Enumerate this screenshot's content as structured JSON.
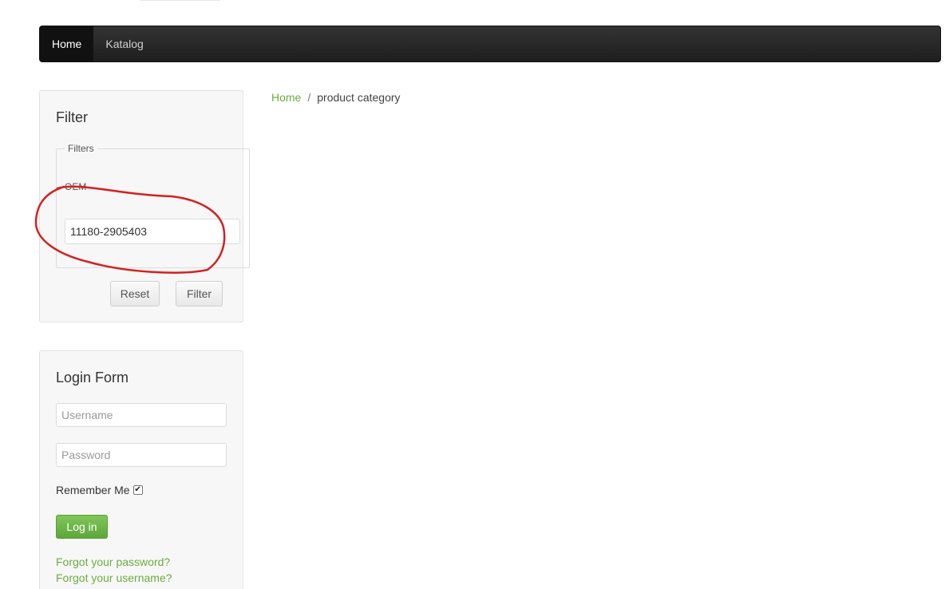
{
  "nav": {
    "items": [
      {
        "label": "Home",
        "active": true
      },
      {
        "label": "Katalog",
        "active": false
      }
    ]
  },
  "breadcrumb": {
    "home": "Home",
    "separator": "/",
    "current": "product category"
  },
  "filter": {
    "title": "Filter",
    "legend": "Filters",
    "field_label": "OEM",
    "oem_value": "11180-2905403",
    "reset_label": "Reset",
    "filter_label": "Filter"
  },
  "login": {
    "title": "Login Form",
    "username_placeholder": "Username",
    "password_placeholder": "Password",
    "remember_label": "Remember Me",
    "remember_checked": true,
    "checkmark": "✔",
    "submit_label": "Log in",
    "forgot_password": "Forgot your password?",
    "forgot_username": "Forgot your username?"
  },
  "colors": {
    "accent_green": "#6aae3f",
    "navbar_bg": "#1e1e1e",
    "annotation_red": "#d42020"
  }
}
